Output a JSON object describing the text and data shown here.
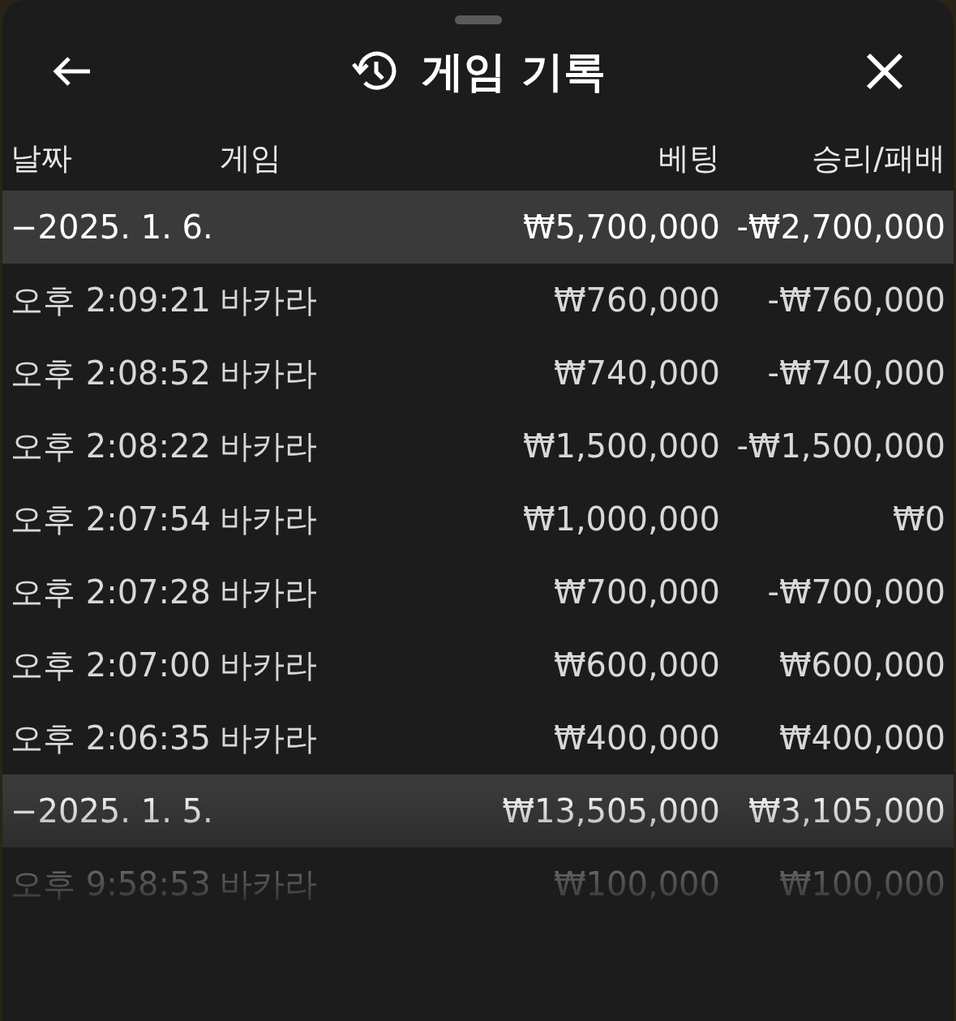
{
  "header": {
    "title": "게임 기록"
  },
  "columns": [
    "날짜",
    "게임",
    "베팅",
    "승리/패배"
  ],
  "groups": [
    {
      "date": "−2025. 1. 6.",
      "bet": "₩5,700,000",
      "result": "-₩2,700,000",
      "rows": [
        {
          "time": "오후 2:09:21",
          "game": "바카라",
          "bet": "₩760,000",
          "result": "-₩760,000"
        },
        {
          "time": "오후 2:08:52",
          "game": "바카라",
          "bet": "₩740,000",
          "result": "-₩740,000"
        },
        {
          "time": "오후 2:08:22",
          "game": "바카라",
          "bet": "₩1,500,000",
          "result": "-₩1,500,000"
        },
        {
          "time": "오후 2:07:54",
          "game": "바카라",
          "bet": "₩1,000,000",
          "result": "₩0"
        },
        {
          "time": "오후 2:07:28",
          "game": "바카라",
          "bet": "₩700,000",
          "result": "-₩700,000"
        },
        {
          "time": "오후 2:07:00",
          "game": "바카라",
          "bet": "₩600,000",
          "result": "₩600,000"
        },
        {
          "time": "오후 2:06:35",
          "game": "바카라",
          "bet": "₩400,000",
          "result": "₩400,000"
        }
      ]
    },
    {
      "date": "−2025. 1. 5.",
      "bet": "₩13,505,000",
      "result": "₩3,105,000",
      "rows": [
        {
          "time": "오후 9:58:53",
          "game": "바카라",
          "bet": "₩100,000",
          "result": "₩100,000"
        }
      ]
    }
  ]
}
